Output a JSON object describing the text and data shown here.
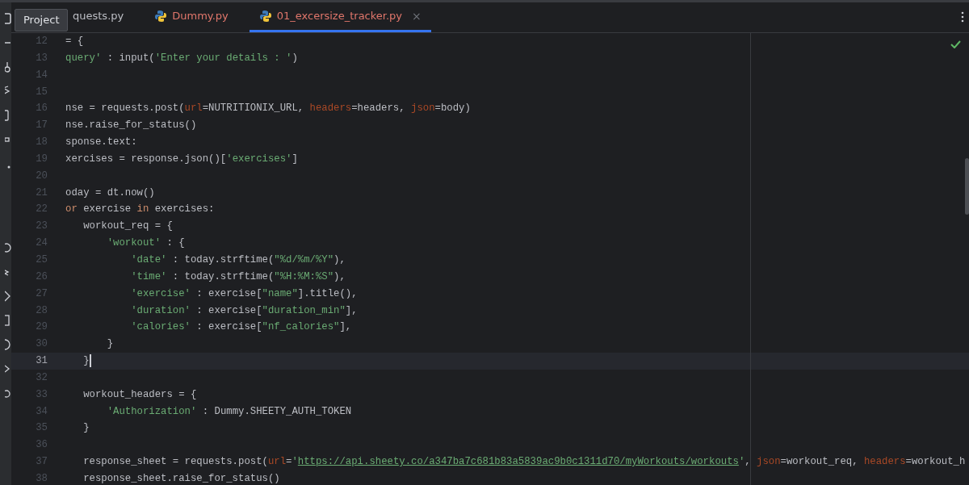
{
  "tooltip": {
    "text": "Project"
  },
  "tabs": [
    {
      "label": "quests.py",
      "selected": false,
      "has_errors": false,
      "icon": false,
      "closable": false
    },
    {
      "label": "Dummy.py",
      "selected": false,
      "has_errors": true,
      "icon": true,
      "closable": false
    },
    {
      "label": "01_excersize_tracker.py",
      "selected": true,
      "has_errors": true,
      "icon": true,
      "closable": true,
      "close": "×"
    }
  ],
  "lines": [
    {
      "number": "12",
      "current": false,
      "tokens": [
        {
          "kind": "plain",
          "text": "= {"
        }
      ]
    },
    {
      "number": "13",
      "current": false,
      "tokens": [
        {
          "kind": "str",
          "text": "query'"
        },
        {
          "kind": "plain",
          "text": " : input("
        },
        {
          "kind": "str",
          "text": "'Enter your details : '"
        },
        {
          "kind": "plain",
          "text": ")"
        }
      ]
    },
    {
      "number": "14",
      "current": false
    },
    {
      "number": "15",
      "current": false
    },
    {
      "number": "16",
      "current": false,
      "tokens": [
        {
          "kind": "plain",
          "text": "nse = requests.post("
        },
        {
          "kind": "param",
          "text": "url"
        },
        {
          "kind": "plain",
          "text": "=NUTRITIONIX_URL, "
        },
        {
          "kind": "param",
          "text": "headers"
        },
        {
          "kind": "plain",
          "text": "=headers, "
        },
        {
          "kind": "param",
          "text": "json"
        },
        {
          "kind": "plain",
          "text": "=body)"
        }
      ]
    },
    {
      "number": "17",
      "current": false,
      "tokens": [
        {
          "kind": "plain",
          "text": "nse.raise_for_status()"
        }
      ]
    },
    {
      "number": "18",
      "current": false,
      "tokens": [
        {
          "kind": "plain",
          "text": "sponse.text:"
        }
      ]
    },
    {
      "number": "19",
      "current": false,
      "tokens": [
        {
          "kind": "plain",
          "text": "xercises = response.json()["
        },
        {
          "kind": "str",
          "text": "'exercises'"
        },
        {
          "kind": "plain",
          "text": "]"
        }
      ]
    },
    {
      "number": "20",
      "current": false
    },
    {
      "number": "21",
      "current": false,
      "tokens": [
        {
          "kind": "plain",
          "text": "oday = dt.now()"
        }
      ]
    },
    {
      "number": "22",
      "current": false,
      "tokens": [
        {
          "kind": "kw",
          "text": "or"
        },
        {
          "kind": "plain",
          "text": " exercise "
        },
        {
          "kind": "kw",
          "text": "in"
        },
        {
          "kind": "plain",
          "text": " exercises:"
        }
      ]
    },
    {
      "number": "23",
      "current": false,
      "tokens": [
        {
          "kind": "plain",
          "text": "   workout_req = {"
        }
      ]
    },
    {
      "number": "24",
      "current": false,
      "tokens": [
        {
          "kind": "str",
          "text": "       'workout'"
        },
        {
          "kind": "plain",
          "text": " : {"
        }
      ]
    },
    {
      "number": "25",
      "current": false,
      "tokens": [
        {
          "kind": "str",
          "text": "           'date'"
        },
        {
          "kind": "plain",
          "text": " : today.strftime("
        },
        {
          "kind": "str",
          "text": "\"%d/%m/%Y\""
        },
        {
          "kind": "plain",
          "text": "),"
        }
      ]
    },
    {
      "number": "26",
      "current": false,
      "tokens": [
        {
          "kind": "str",
          "text": "           'time'"
        },
        {
          "kind": "plain",
          "text": " : today.strftime("
        },
        {
          "kind": "str",
          "text": "\"%H:%M:%S\""
        },
        {
          "kind": "plain",
          "text": "),"
        }
      ]
    },
    {
      "number": "27",
      "current": false,
      "tokens": [
        {
          "kind": "str",
          "text": "           'exercise'"
        },
        {
          "kind": "plain",
          "text": " : exercise["
        },
        {
          "kind": "str",
          "text": "\"name\""
        },
        {
          "kind": "plain",
          "text": "].title(),"
        }
      ]
    },
    {
      "number": "28",
      "current": false,
      "tokens": [
        {
          "kind": "str",
          "text": "           'duration'"
        },
        {
          "kind": "plain",
          "text": " : exercise["
        },
        {
          "kind": "str",
          "text": "\"duration_min\""
        },
        {
          "kind": "plain",
          "text": "],"
        }
      ]
    },
    {
      "number": "29",
      "current": false,
      "tokens": [
        {
          "kind": "str",
          "text": "           'calories'"
        },
        {
          "kind": "plain",
          "text": " : exercise["
        },
        {
          "kind": "str",
          "text": "\"nf_calories\""
        },
        {
          "kind": "plain",
          "text": "],"
        }
      ]
    },
    {
      "number": "30",
      "current": false,
      "tokens": [
        {
          "kind": "plain",
          "text": "       }"
        }
      ]
    },
    {
      "number": "31",
      "current": true,
      "tokens": [
        {
          "kind": "plain",
          "text": "   }"
        }
      ]
    },
    {
      "number": "32",
      "current": false
    },
    {
      "number": "33",
      "current": false,
      "tokens": [
        {
          "kind": "plain",
          "text": "   workout_headers = {"
        }
      ]
    },
    {
      "number": "34",
      "current": false,
      "tokens": [
        {
          "kind": "str",
          "text": "       'Authorization'"
        },
        {
          "kind": "plain",
          "text": " : Dummy.SHEETY_AUTH_TOKEN"
        }
      ]
    },
    {
      "number": "35",
      "current": false,
      "tokens": [
        {
          "kind": "plain",
          "text": "   }"
        }
      ]
    },
    {
      "number": "36",
      "current": false
    },
    {
      "number": "37",
      "current": false,
      "tokens": [
        {
          "kind": "plain",
          "text": "   response_sheet = requests.post("
        },
        {
          "kind": "param",
          "text": "url"
        },
        {
          "kind": "plain",
          "text": "="
        },
        {
          "kind": "str",
          "text": "'"
        },
        {
          "kind": "url",
          "text": "https://api.sheety.co/a347ba7c681b83a5839ac9b0c1311d70/myWorkouts/workouts"
        },
        {
          "kind": "str",
          "text": "'"
        },
        {
          "kind": "plain",
          "text": ", "
        },
        {
          "kind": "param",
          "text": "json"
        },
        {
          "kind": "plain",
          "text": "=workout_req, "
        },
        {
          "kind": "param",
          "text": "headers"
        },
        {
          "kind": "plain",
          "text": "=workout_h"
        }
      ]
    },
    {
      "number": "38",
      "current": false,
      "tokens": [
        {
          "kind": "plain",
          "text": "   response_sheet.raise_for_status()"
        }
      ]
    }
  ]
}
